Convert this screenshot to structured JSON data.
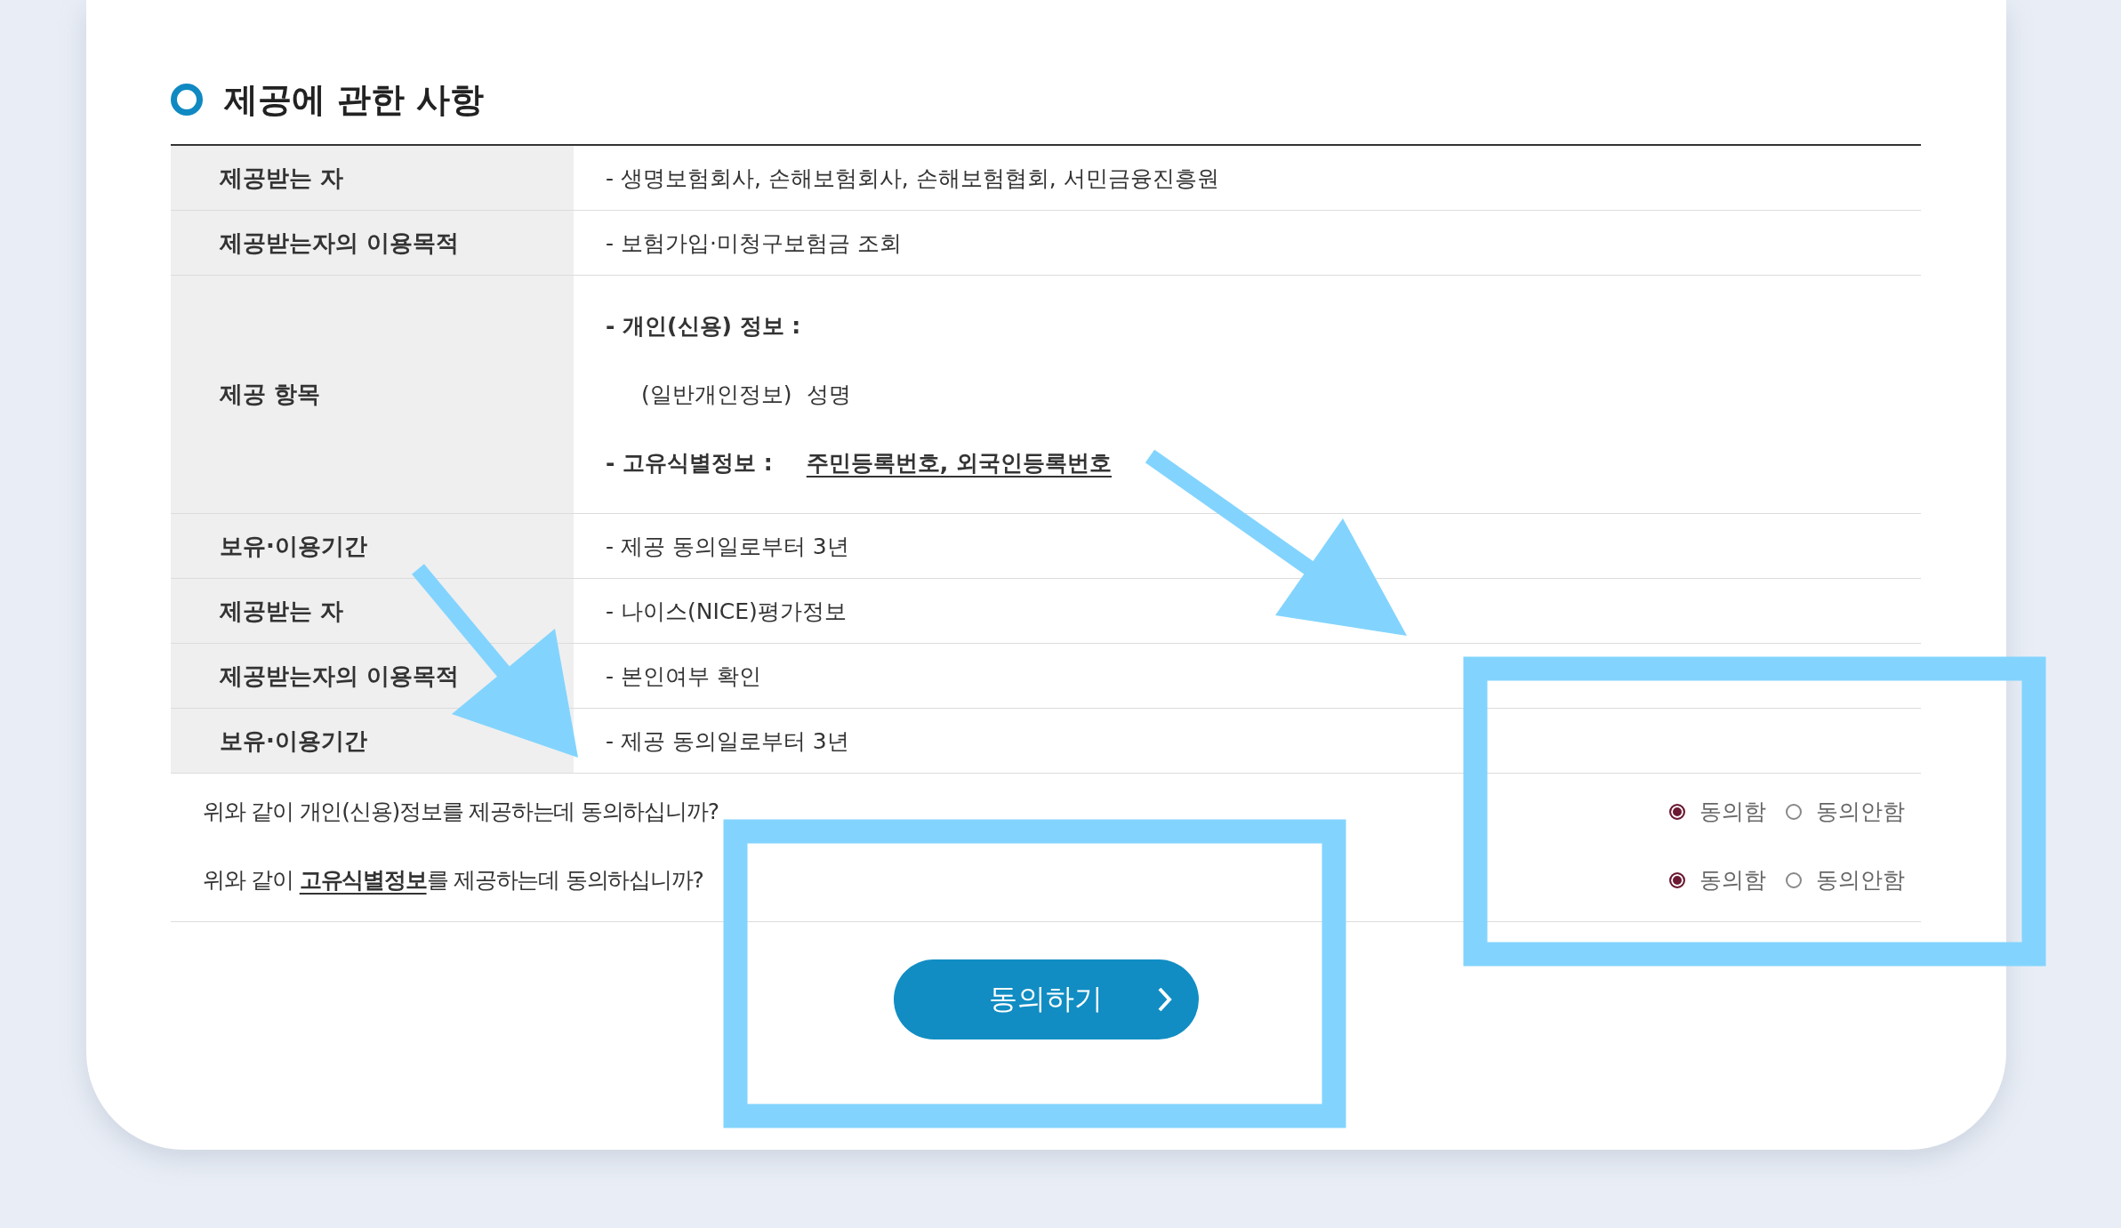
{
  "section_title": "제공에 관한 사항",
  "rows": [
    {
      "label": "제공받는 자",
      "kind": "text",
      "value": "- 생명보험회사, 손해보험회사, 손해보험협회, 서민금융진흥원"
    },
    {
      "label": "제공받는자의 이용목적",
      "kind": "text",
      "value": "- 보험가입·미청구보험금 조회"
    },
    {
      "label": "제공 항목",
      "kind": "items",
      "lines": [
        {
          "kind": "heading",
          "text": "- 개인(신용) 정보 :"
        },
        {
          "kind": "indent",
          "label": "(일반개인정보)",
          "value": "성명"
        },
        {
          "kind": "labeled",
          "label": "- 고유식별정보 :",
          "value": "주민등록번호, 외국인등록번호"
        }
      ]
    },
    {
      "label": "보유·이용기간",
      "kind": "text",
      "value": "- 제공 동의일로부터 3년"
    },
    {
      "label": "제공받는 자",
      "kind": "text",
      "value": "- 나이스(NICE)평가정보"
    },
    {
      "label": "제공받는자의 이용목적",
      "kind": "text",
      "value": "- 본인여부 확인"
    },
    {
      "label": "보유·이용기간",
      "kind": "text",
      "value": "- 제공 동의일로부터 3년"
    }
  ],
  "questions": [
    {
      "text": "위와 같이 개인(신용)정보를 제공하는데 동의하십니까?",
      "options": [
        {
          "label": "동의함",
          "selected": true
        },
        {
          "label": "동의안함",
          "selected": false
        }
      ]
    },
    {
      "text": "위와 같이 **고유식별정보**를 제공하는데 동의하십니까?",
      "options": [
        {
          "label": "동의함",
          "selected": true
        },
        {
          "label": "동의안함",
          "selected": false
        }
      ]
    }
  ],
  "agree_button": "동의하기"
}
